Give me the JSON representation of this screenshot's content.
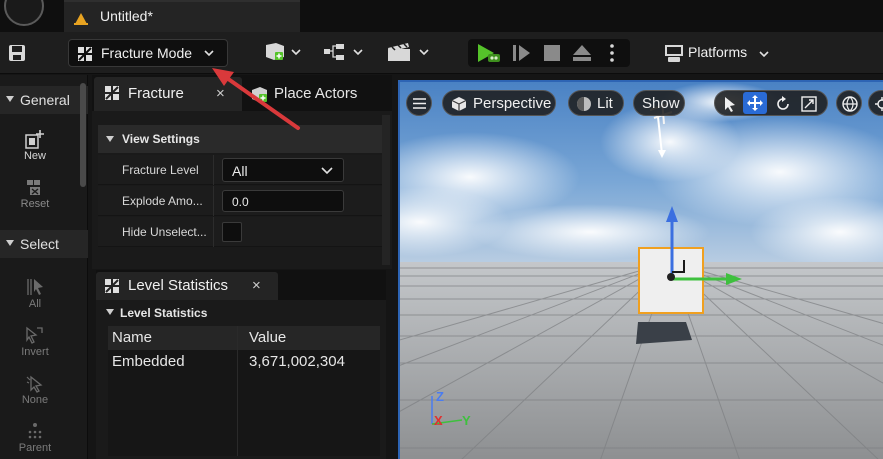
{
  "title_bar": {
    "tab_title": "Untitled*"
  },
  "toolbar": {
    "mode_label": "Fracture Mode",
    "platforms_label": "Platforms"
  },
  "sidebar": {
    "general_label": "General",
    "select_label": "Select",
    "tools": {
      "new": "New",
      "reset": "Reset",
      "all": "All",
      "invert": "Invert",
      "none": "None",
      "parent": "Parent"
    }
  },
  "fracture_panel": {
    "tab_label": "Fracture",
    "tab_close": "×",
    "place_tab_label": "Place Actors",
    "view_settings_label": "View Settings",
    "properties": {
      "fracture_level_name": "Fracture Level",
      "fracture_level_value": "All",
      "explode_name": "Explode Amo...",
      "explode_value": "0.0",
      "hide_name": "Hide Unselect..."
    }
  },
  "level_statistics": {
    "tab_label": "Level Statistics",
    "tab_close": "×",
    "section_label": "Level Statistics",
    "columns": [
      "Name",
      "Value"
    ],
    "rows": [
      {
        "name": "Embedded",
        "value": "3,671,002,304"
      }
    ]
  },
  "viewport": {
    "perspective_label": "Perspective",
    "lit_label": "Lit",
    "show_label": "Show",
    "axis": {
      "z": "Z",
      "x": "X",
      "y": "Y"
    }
  },
  "colors": {
    "accent_blue": "#2d64b4",
    "play_green": "#55c32a",
    "selection_orange": "#f0a020",
    "annotation_arrow": "#d9393b"
  }
}
